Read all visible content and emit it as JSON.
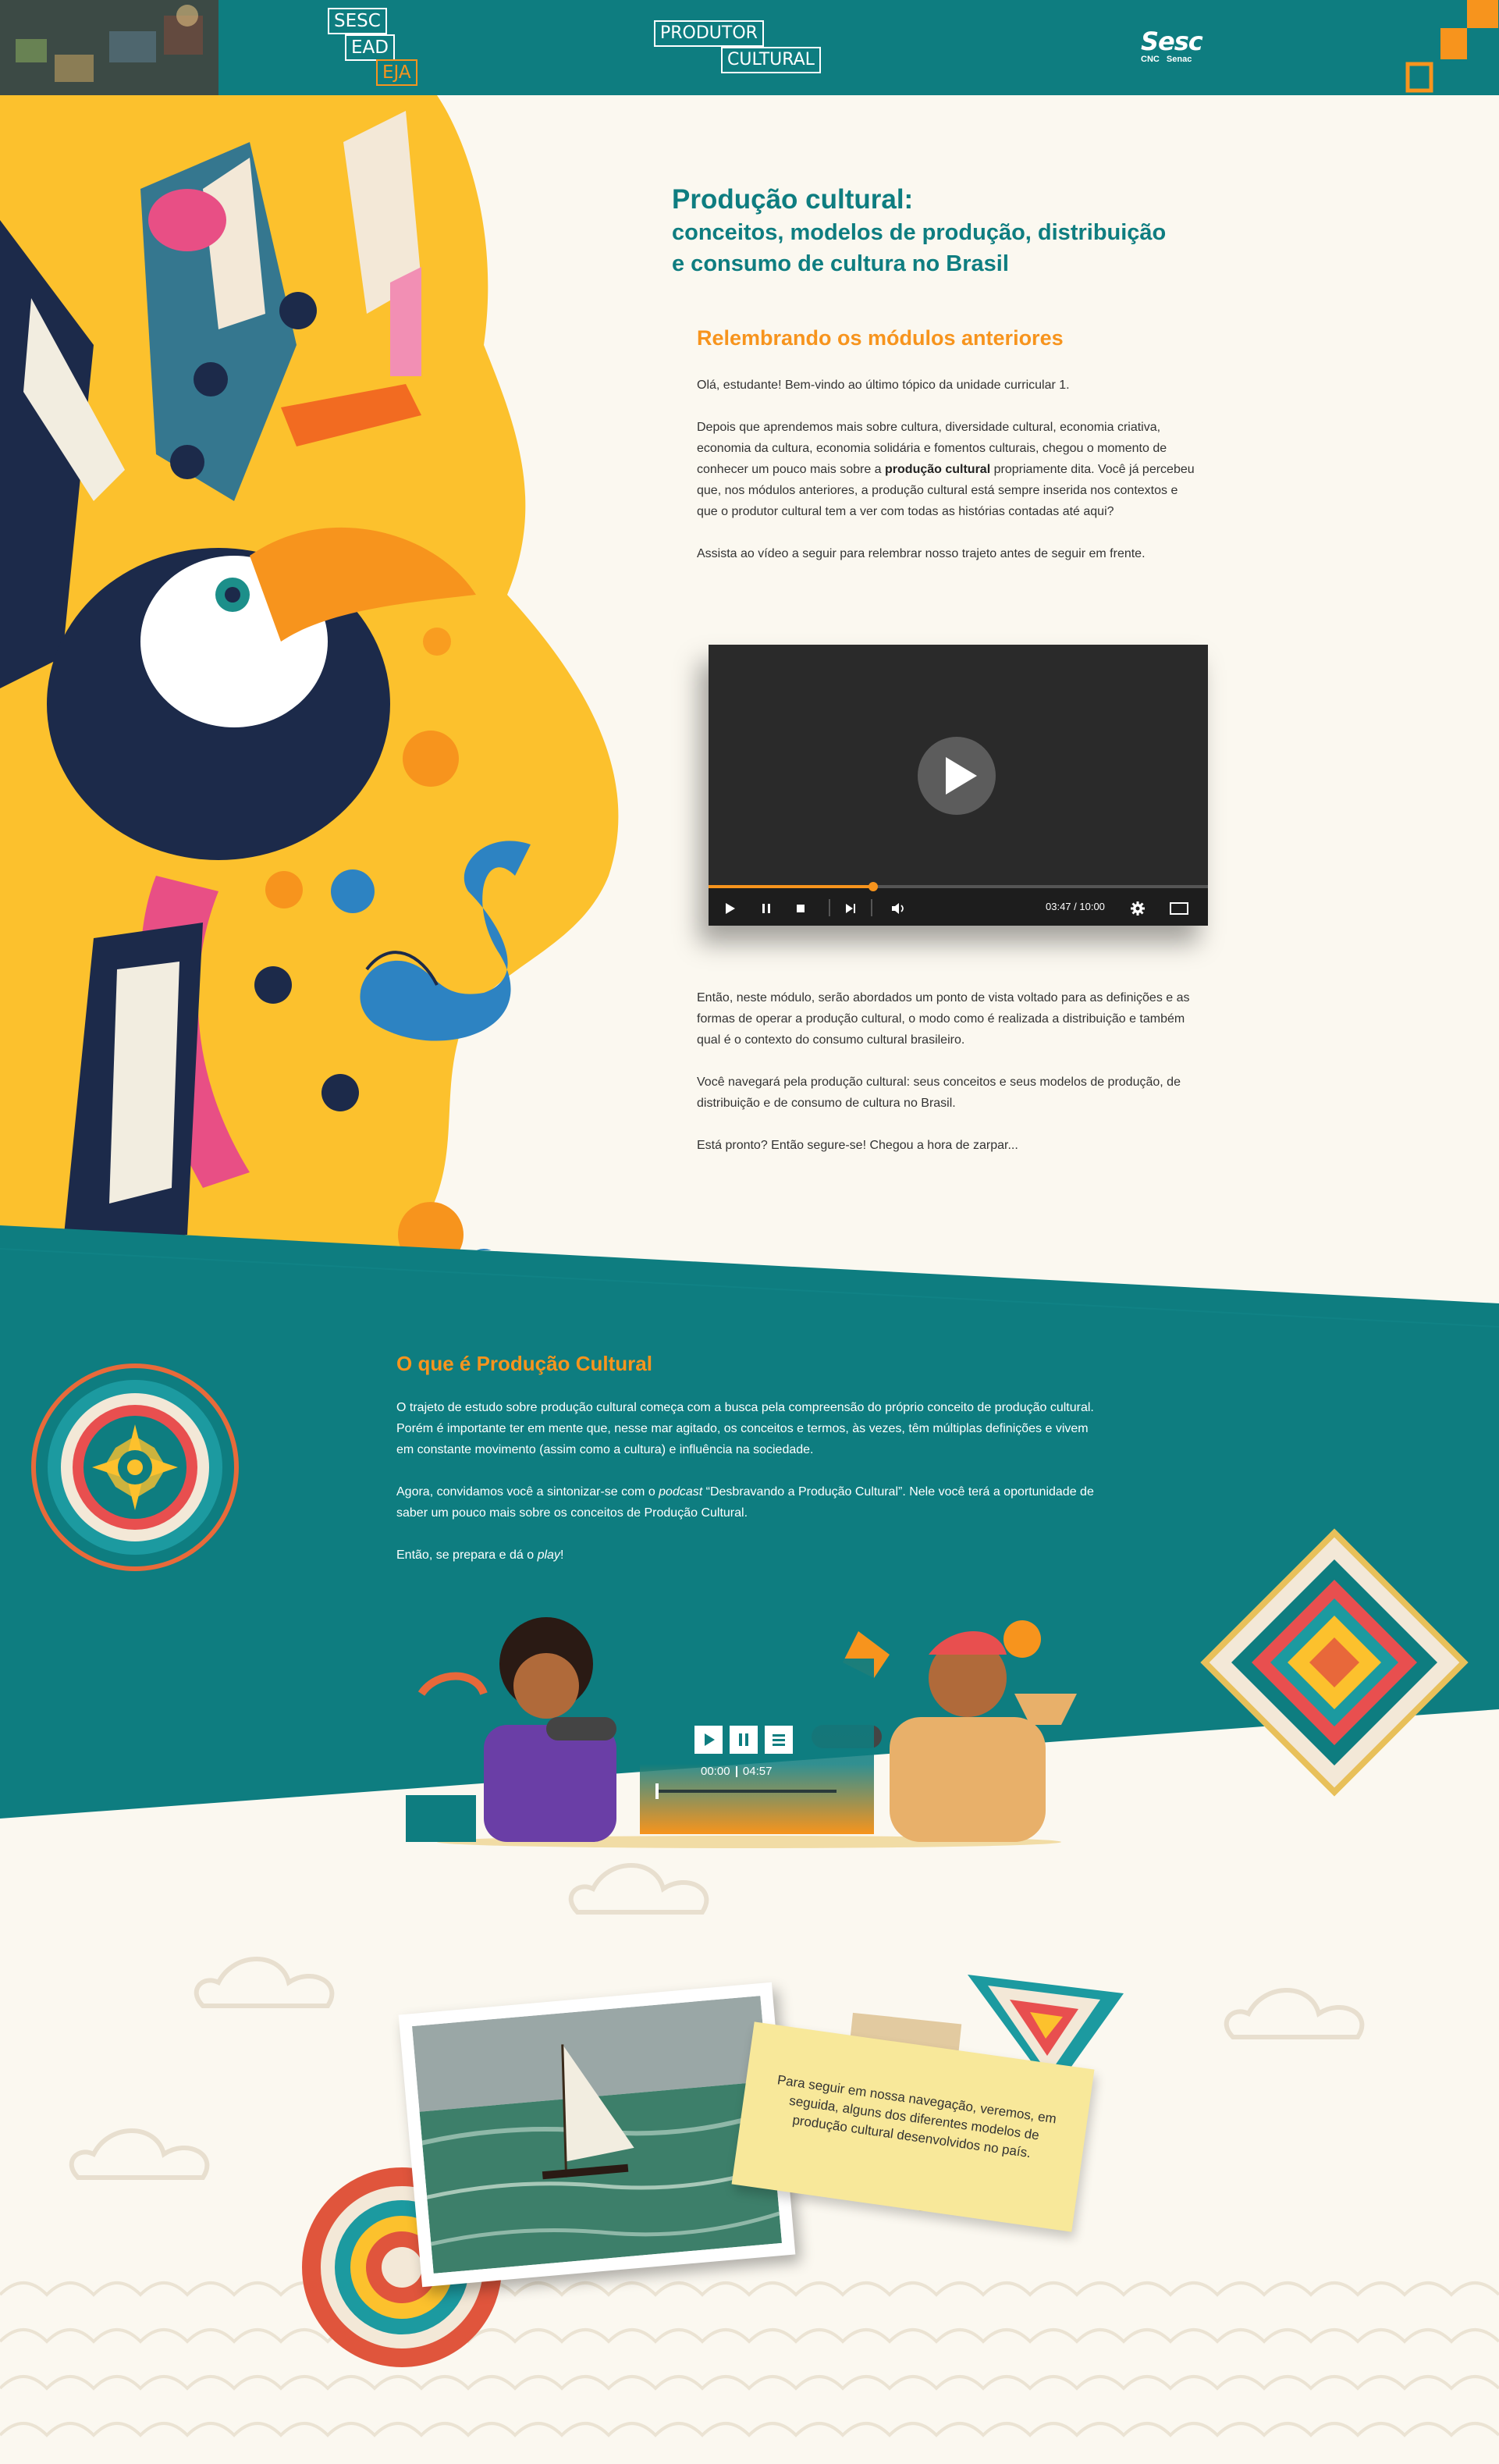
{
  "header": {
    "logo_sesc": "SESC",
    "logo_ead": "EAD",
    "logo_eja": "EJA",
    "produtor_line1": "PRODUTOR",
    "produtor_line2": "CULTURAL",
    "brand_main": "Sesc",
    "brand_sub1": "CNC",
    "brand_sub2": "Senac"
  },
  "hero": {
    "title_line1": "Produção cultural:",
    "title_line2": "conceitos, modelos de produção, distribuição",
    "title_line3": "e consumo de cultura no Brasil",
    "section_heading": "Relembrando os módulos anteriores",
    "p1": "Olá, estudante! Bem-vindo ao último tópico da unidade curricular 1.",
    "p2_a": "Depois que aprendemos mais sobre cultura, diversidade cultural, economia criativa, economia da cultura, economia solidária e fomentos culturais, chegou o momento de conhecer um pouco mais sobre a ",
    "p2_bold": "produção cultural",
    "p2_b": " propriamente dita. Você já percebeu que, nos módulos anteriores, a produção cultural está sempre inserida nos contextos e que o produtor cultural tem a ver com todas as histórias contadas até aqui?",
    "p3": "Assista ao vídeo a seguir para relembrar nosso trajeto antes de seguir em frente.",
    "p4": "Então, neste módulo, serão abordados um ponto de vista voltado para as definições e as formas de operar a produção cultural, o modo como é realizada a distribuição e também qual é o contexto do consumo cultural brasileiro.",
    "p5": "Você navegará pela produção cultural: seus conceitos e seus modelos de produção, de distribuição e de consumo de cultura no Brasil.",
    "p6": "Está pronto? Então segure-se! Chegou a hora de zarpar..."
  },
  "video": {
    "time": "03:47 / 10:00",
    "progress": 0.33
  },
  "section2": {
    "heading": "O que é Produção Cultural",
    "p1": "O trajeto de estudo sobre produção cultural começa com a busca pela compreensão do próprio conceito de produção cultural. Porém é importante ter em mente que, nesse mar agitado, os conceitos e termos, às vezes, têm múltiplas definições e vivem em constante movimento (assim como a cultura) e influência na sociedade.",
    "p2_a": "Agora, convidamos você a sintonizar-se com o ",
    "p2_italic": "podcast",
    "p2_b": " “Desbravando a Produção Cultural”. Nele você terá a oportunidade de saber um pouco mais sobre os conceitos de Produção Cultural.",
    "p3_a": "Então, se prepara e dá o ",
    "p3_italic": "play",
    "p3_b": "!"
  },
  "podcast": {
    "time_current": "00:00",
    "time_total": "04:57",
    "progress": 0.0
  },
  "note": {
    "text": "Para seguir em nossa navegação, veremos, em seguida, alguns dos diferentes modelos de produção cultural desenvolvidos no país."
  },
  "colors": {
    "teal": "#0e7d80",
    "orange": "#f7941d",
    "yellow": "#fcc12d",
    "cream": "#fbf8f0"
  }
}
